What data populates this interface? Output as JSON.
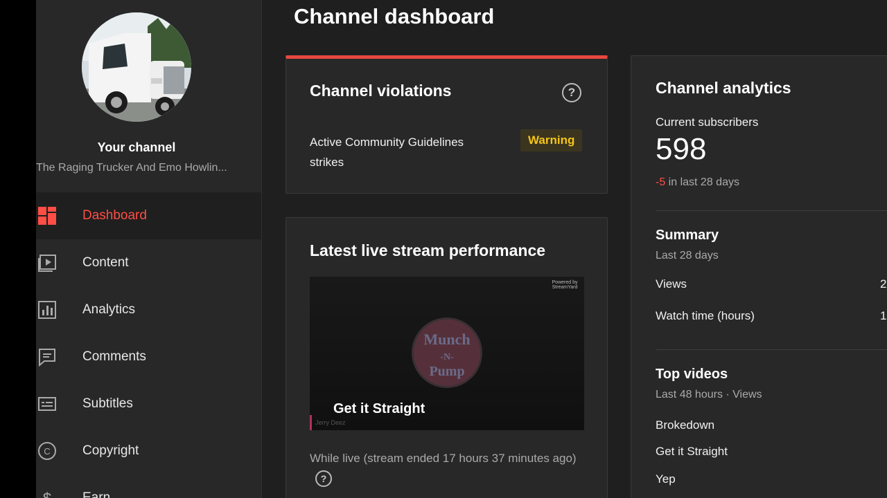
{
  "page_title": "Channel dashboard",
  "sidebar": {
    "channel_title": "Your channel",
    "channel_name": "The Raging Trucker And Emo Howlin...",
    "items": [
      {
        "label": "Dashboard",
        "icon": "dashboard-icon",
        "active": true
      },
      {
        "label": "Content",
        "icon": "content-icon"
      },
      {
        "label": "Analytics",
        "icon": "analytics-icon"
      },
      {
        "label": "Comments",
        "icon": "comments-icon"
      },
      {
        "label": "Subtitles",
        "icon": "subtitles-icon"
      },
      {
        "label": "Copyright",
        "icon": "copyright-icon"
      },
      {
        "label": "Earn",
        "icon": "earn-icon"
      }
    ]
  },
  "violations": {
    "title": "Channel violations",
    "help": "?",
    "text": "Active Community Guidelines strikes",
    "badge": "Warning"
  },
  "live": {
    "title": "Latest live stream performance",
    "thumb_title": "Get it Straight",
    "thumb_sub": "Jerry Deez",
    "thumb_mark": "Powered by StreamYard",
    "logo_lines": [
      "Munch",
      "-N-",
      "Pump"
    ],
    "caption": "While live (stream ended 17 hours 37 minutes ago)",
    "help": "?"
  },
  "analytics": {
    "title": "Channel analytics",
    "subs_label": "Current subscribers",
    "subs_value": "598",
    "subs_change": "-5",
    "subs_change_suffix": " in last 28 days",
    "summary_title": "Summary",
    "summary_sub": "Last 28 days",
    "views_label": "Views",
    "views_value": "2",
    "watch_label": "Watch time (hours)",
    "watch_value": "1",
    "top_title": "Top videos",
    "top_sub": "Last 48 hours · Views",
    "top_videos": [
      "Brokedown",
      "Get it Straight",
      "Yep"
    ]
  },
  "colors": {
    "accent": "#ff4e45",
    "warning": "#f5c518",
    "background": "#1f1f1f",
    "card": "#282828"
  }
}
